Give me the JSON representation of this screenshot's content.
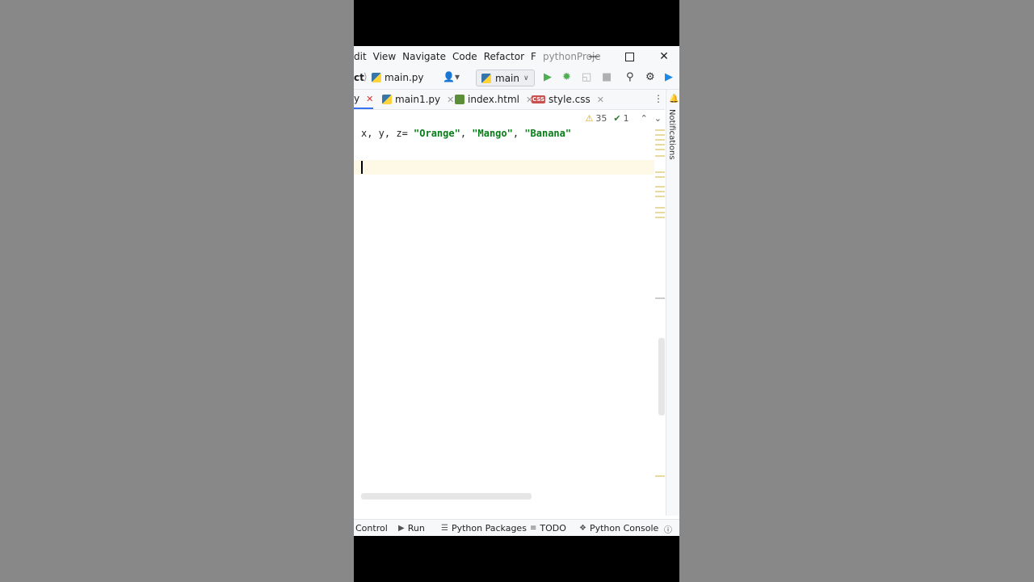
{
  "menubar": {
    "items": [
      {
        "label": "dit"
      },
      {
        "label": "View"
      },
      {
        "label": "Navigate"
      },
      {
        "label": "Code"
      },
      {
        "label": "Refactor"
      },
      {
        "label": "F"
      }
    ],
    "project_title": "pythonProje"
  },
  "toolbar": {
    "crumb": "ct",
    "file": "main.py",
    "branch": "main"
  },
  "tabs": [
    {
      "label": "y",
      "active": true
    },
    {
      "label": "main1.py"
    },
    {
      "label": "index.html"
    },
    {
      "label": "style.css"
    }
  ],
  "right_strip": {
    "notifications_label": "Notifications"
  },
  "editor": {
    "warnings_count": "35",
    "ok_count": "1",
    "line1": {
      "prefix": "x, y, z= ",
      "s1": "\"Orange\"",
      "sep1": ", ",
      "s2": "\"Mango\"",
      "sep2": ", ",
      "s3": "\"Banana\""
    }
  },
  "bottombar": {
    "items": [
      {
        "label": "Control"
      },
      {
        "label": "Run"
      },
      {
        "label": "Python Packages"
      },
      {
        "label": "TODO"
      },
      {
        "label": "Python Console"
      }
    ]
  },
  "colors": {
    "string": "#067d17",
    "accent": "#3574f0",
    "current_line": "#fdf9e6"
  }
}
